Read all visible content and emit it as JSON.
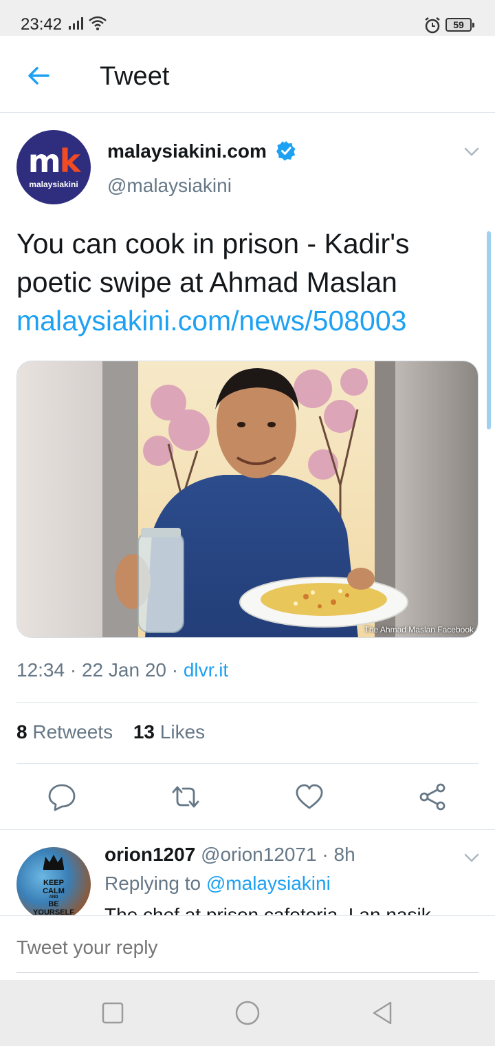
{
  "status_bar": {
    "time": "23:42",
    "battery": "59",
    "icons": [
      "signal-icon",
      "wifi-icon",
      "alarm-icon",
      "battery-icon"
    ]
  },
  "header": {
    "back_icon": "arrow-left-icon",
    "title": "Tweet"
  },
  "tweet": {
    "avatar_mark_m": "m",
    "avatar_mark_k": "k",
    "avatar_text": "malaysiakini",
    "display_name": "malaysiakini.com",
    "handle": "@malaysiakini",
    "verified": true,
    "text_line1": "You can cook in prison - Kadir's",
    "text_line2": "poetic swipe at Ahmad Maslan",
    "link": "malaysiakini.com/news/508003",
    "media_caption": "The Ahmad Maslan Facebook",
    "time": "12:34",
    "date": "22 Jan 20",
    "separator": "·",
    "source": "dlvr.it",
    "retweets_count": "8",
    "retweets_label": "Retweets",
    "likes_count": "13",
    "likes_label": "Likes",
    "actions": [
      "reply-icon",
      "retweet-icon",
      "like-icon",
      "share-icon"
    ]
  },
  "reply": {
    "avatar_line1": "KEEP",
    "avatar_line2": "CALM",
    "avatar_line3": "AND",
    "avatar_line4": "BE",
    "avatar_line5": "YOURSELF",
    "display_name": "orion1207",
    "handle": "@orion12071",
    "age": "· 8h",
    "replying_prefix": "Replying to",
    "replying_to": "@malaysiakini",
    "text": "The chef at prison cafeteria. Lan nasik"
  },
  "compose": {
    "placeholder": "Tweet your reply"
  },
  "colors": {
    "accent": "#1da1f2",
    "secondary_text": "#657786",
    "avatar_bg": "#2f2d7e"
  }
}
